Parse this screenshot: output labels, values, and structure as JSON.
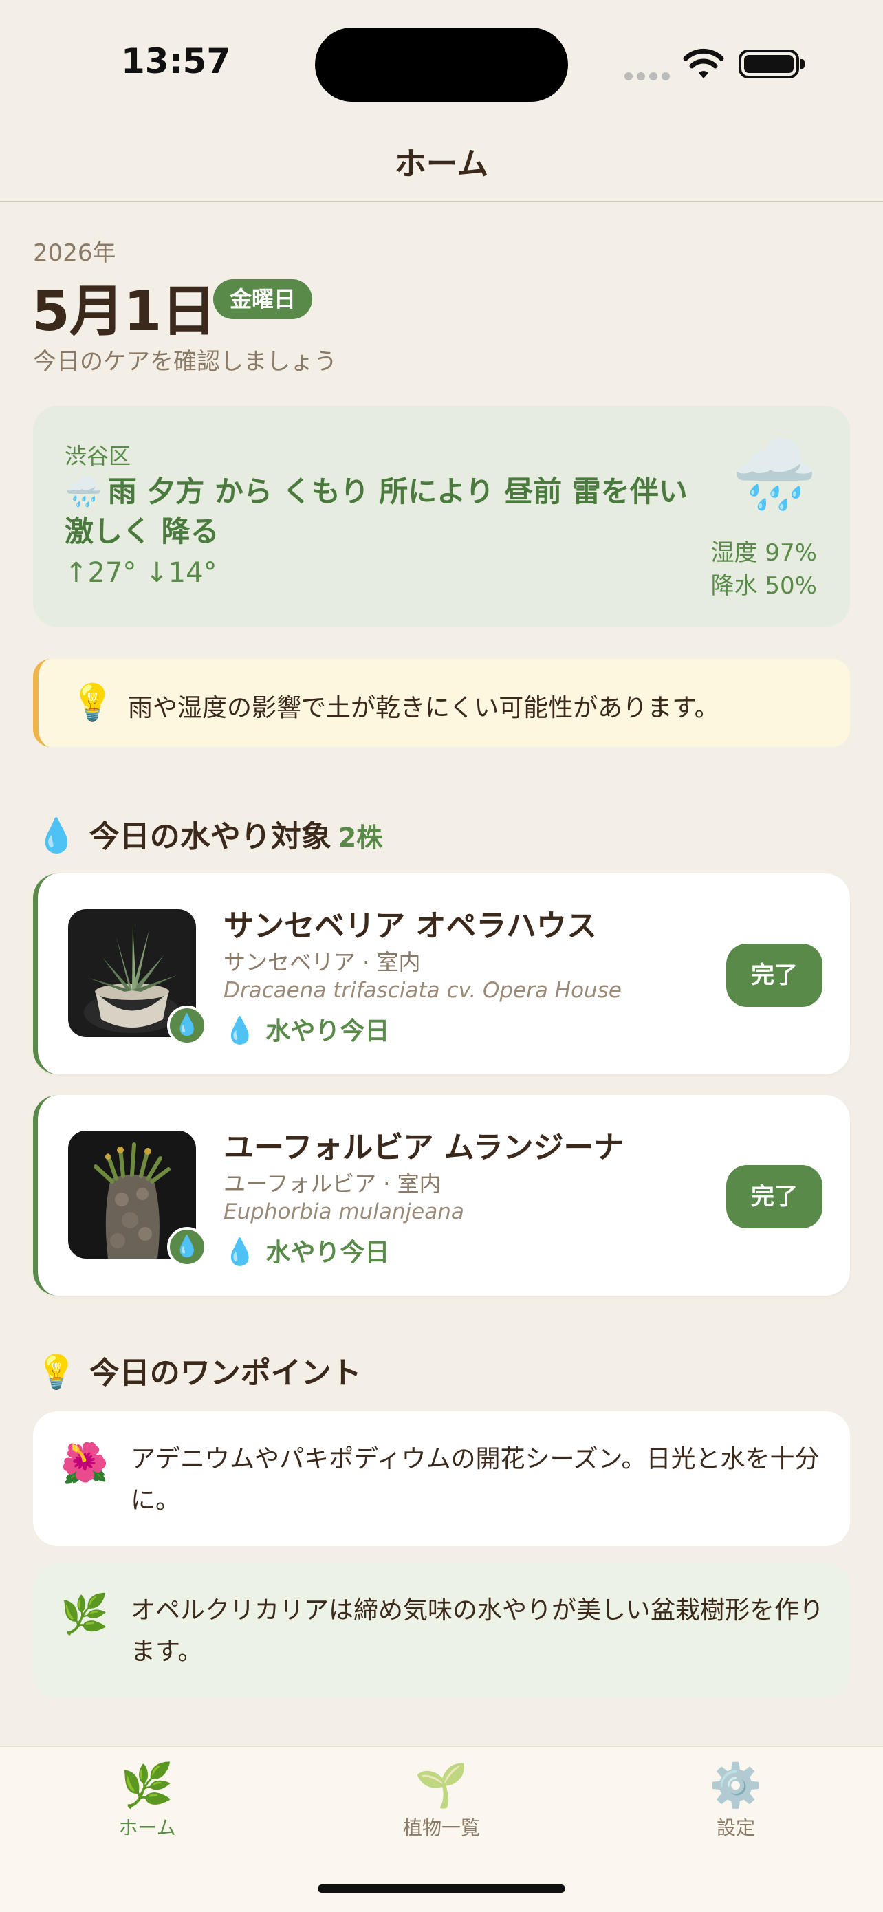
{
  "status_bar": {
    "time": "13:57"
  },
  "nav": {
    "title": "ホーム"
  },
  "header": {
    "year": "2026年",
    "date": "5月1日",
    "weekday": "金曜日",
    "subtitle": "今日のケアを確認しましょう"
  },
  "weather": {
    "location": "渋谷区",
    "icon_small": "🌧️",
    "description": "雨 夕方 から くもり 所により 昼前 雷を伴い 激しく 降る",
    "temps": "↑27° ↓14°",
    "icon_large": "🌧️",
    "humidity": "湿度 97%",
    "precipitation": "降水 50%"
  },
  "tip_banner": {
    "icon": "💡",
    "text": "雨や湿度の影響で土が乾きにくい可能性があります。"
  },
  "watering_section": {
    "icon": "💧",
    "title": "今日の水やり対象",
    "count": "2株"
  },
  "plants": [
    {
      "name": "サンセベリア オペラハウス",
      "meta": "サンセベリア · 室内",
      "scientific": "Dracaena trifasciata cv. Opera House",
      "water_icon": "💧",
      "water_label": "水やり今日",
      "badge_icon": "💧",
      "done_label": "完了"
    },
    {
      "name": "ユーフォルビア ムランジーナ",
      "meta": "ユーフォルビア · 室内",
      "scientific": "Euphorbia mulanjeana",
      "water_icon": "💧",
      "water_label": "水やり今日",
      "badge_icon": "💧",
      "done_label": "完了"
    }
  ],
  "onepoint_section": {
    "icon": "💡",
    "title": "今日のワンポイント"
  },
  "onepoints": [
    {
      "icon": "🌺",
      "text": "アデニウムやパキポディウムの開花シーズン。日光と水を十分に。"
    },
    {
      "icon": "🌿",
      "text": "オペルクリカリアは締め気味の水やりが美しい盆栽樹形を作ります。"
    }
  ],
  "tabs": [
    {
      "icon": "🌿",
      "label": "ホーム",
      "active": true
    },
    {
      "icon": "🌱",
      "label": "植物一覧",
      "active": false
    },
    {
      "icon": "⚙️",
      "label": "設定",
      "active": false
    }
  ],
  "colors": {
    "background": "#f4efe6",
    "accent_green": "#5a8a4a",
    "weather_card": "#e6ecdf",
    "tip_background": "#fdf7e0",
    "tip_border": "#f0b54a",
    "text_brown": "#3b2a1c"
  }
}
